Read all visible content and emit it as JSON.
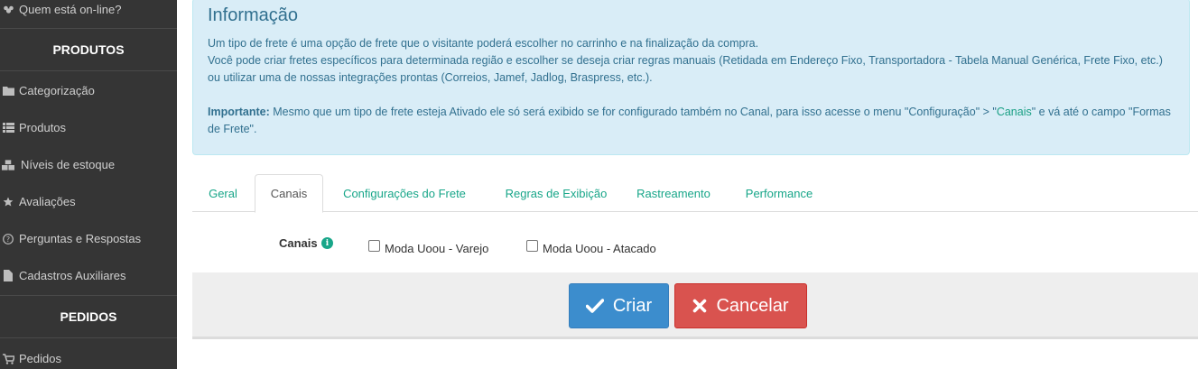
{
  "sidebar": {
    "online_label": "Quem está on-line?",
    "products_header": "PRODUTOS",
    "items": [
      {
        "label": "Categorização",
        "icon": "folder-icon"
      },
      {
        "label": "Produtos",
        "icon": "list-icon"
      },
      {
        "label": "Níveis de estoque",
        "icon": "cubes-icon"
      },
      {
        "label": "Avaliações",
        "icon": "star-icon"
      },
      {
        "label": "Perguntas e Respostas",
        "icon": "question-circle-icon"
      },
      {
        "label": "Cadastros Auxiliares",
        "icon": "file-icon"
      }
    ],
    "orders_header": "PEDIDOS",
    "orders_item": {
      "label": "Pedidos",
      "icon": "cart-icon"
    }
  },
  "info": {
    "title": "Informação",
    "line1": "Um tipo de frete é uma opção de frete que o visitante poderá escolher no carrinho e na finalização da compra.",
    "line2": "Você pode criar fretes específicos para determinada região e escolher se deseja criar regras manuais (Retidada em Endereço Fixo, Transportadora - Tabela Manual Genérica, Frete Fixo, etc.) ou utilizar uma de nossas integrações prontas (Correios, Jamef, Jadlog, Braspress, etc.).",
    "important_label": "Importante:",
    "important_text_before": " Mesmo que um tipo de frete esteja Ativado ele só será exibido se for configurado também no Canal, para isso acesse o menu \"Configuração\" > \"",
    "important_link": "Canais",
    "important_text_after": "\" e vá até o campo \"Formas de Frete\"."
  },
  "tabs": [
    {
      "label": "Geral",
      "active": false
    },
    {
      "label": "Canais",
      "active": true
    },
    {
      "label": "Configurações do Frete",
      "active": false
    },
    {
      "label": "Regras de Exibição",
      "active": false
    },
    {
      "label": "Rastreamento",
      "active": false
    },
    {
      "label": "Performance",
      "active": false
    }
  ],
  "canais": {
    "label": "Canais",
    "options": [
      {
        "label": "Moda Uoou - Varejo",
        "checked": false
      },
      {
        "label": "Moda Uoou - Atacado",
        "checked": false
      }
    ]
  },
  "actions": {
    "create_label": "Criar",
    "cancel_label": "Cancelar"
  },
  "colors": {
    "sidebar_bg": "#353535",
    "info_bg": "#d9edf7",
    "info_text": "#31708f",
    "link_green": "#18a689",
    "primary": "#3c8dcd",
    "danger": "#d9534f"
  }
}
